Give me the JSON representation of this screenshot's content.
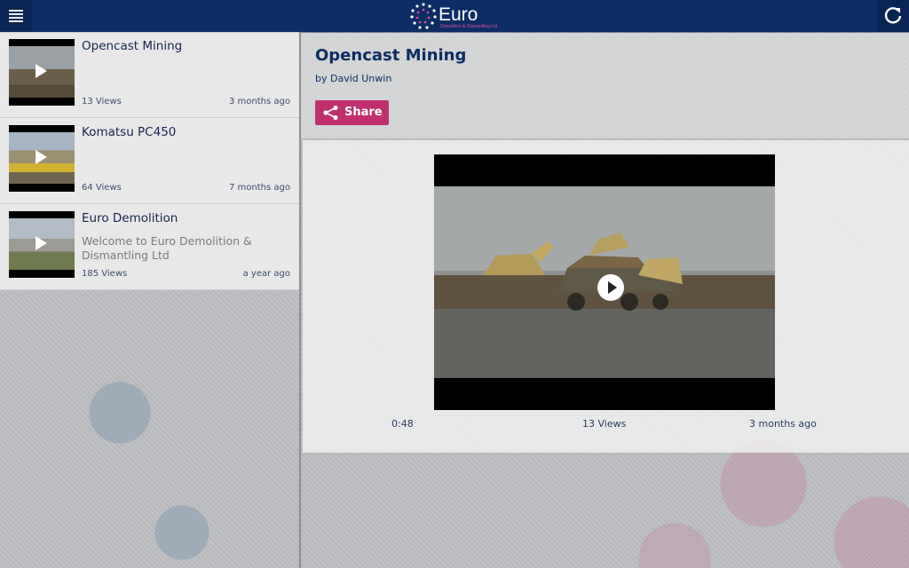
{
  "app": {
    "logo_text": "Euro",
    "logo_sub": "Demolition & Dismantling Ltd",
    "brand_color": "#0c2d63",
    "accent_color": "#c0306e"
  },
  "header": {
    "menu_icon": "hamburger-menu-icon",
    "refresh_icon": "refresh-icon"
  },
  "videos": [
    {
      "title": "Opencast Mining",
      "description": "",
      "views": "13 Views",
      "date": "3 months ago"
    },
    {
      "title": "Komatsu PC450",
      "description": "",
      "views": "64 Views",
      "date": "7 months ago"
    },
    {
      "title": "Euro Demolition",
      "description": "Welcome to Euro Demolition & Dismantling Ltd",
      "views": "185 Views",
      "date": "a year ago"
    }
  ],
  "detail": {
    "title": "Opencast Mining",
    "author": "by David Unwin",
    "share_label": "Share",
    "duration": "0:48",
    "views": "13 Views",
    "date": "3 months ago"
  }
}
